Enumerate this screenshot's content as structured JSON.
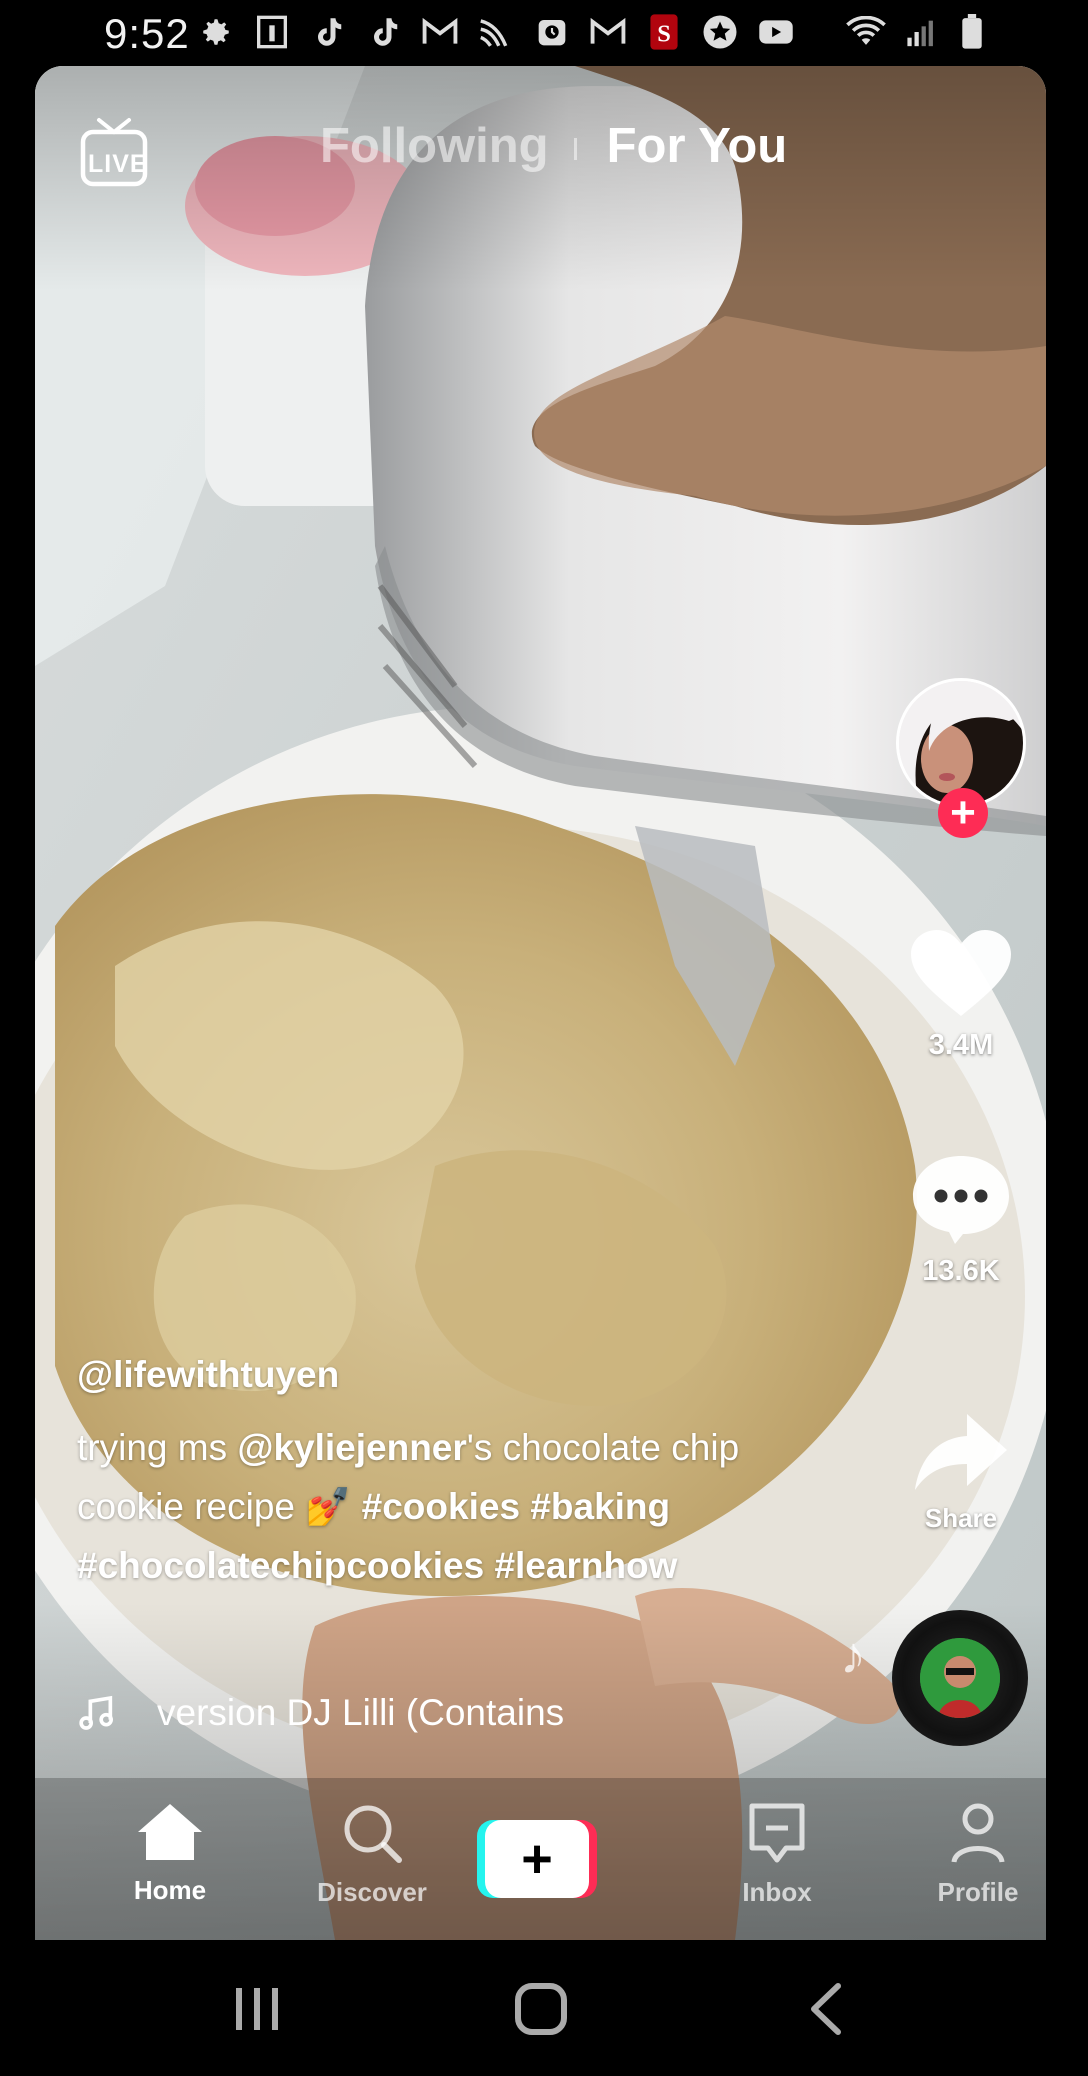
{
  "status_bar": {
    "time": "9:52",
    "icons": [
      "settings-icon",
      "notification-icon",
      "tiktok-icon",
      "tiktok-icon",
      "gmail-icon",
      "sprint-icon",
      "alarm-icon",
      "gmail-icon",
      "stanford-icon",
      "star-icon",
      "youtube-icon"
    ],
    "right_icons": [
      "wifi-icon",
      "signal-icon",
      "battery-icon"
    ]
  },
  "top_nav": {
    "live_label": "LIVE",
    "tabs": [
      {
        "label": "Following",
        "active": false
      },
      {
        "label": "For You",
        "active": true
      }
    ]
  },
  "actions": {
    "like_count": "3.4M",
    "comment_count": "13.6K",
    "share_label": "Share"
  },
  "post": {
    "username": "@lifewithtuyen",
    "caption_prefix": "trying ms ",
    "mention": "@kyliejenner",
    "caption_middle": "'s chocolate chip cookie recipe ",
    "emoji": "💅",
    "hashtags": [
      "#cookies",
      "#baking",
      "#chocolatechipcookies",
      "#learnhow"
    ],
    "sound": "version DJ Lilli (Contains"
  },
  "bottom_nav": {
    "items": [
      {
        "label": "Home",
        "icon": "home-icon",
        "active": true
      },
      {
        "label": "Discover",
        "icon": "search-icon",
        "active": false
      },
      {
        "label": "",
        "icon": "plus-icon",
        "active": false
      },
      {
        "label": "Inbox",
        "icon": "inbox-icon",
        "active": false
      },
      {
        "label": "Profile",
        "icon": "profile-icon",
        "active": false
      }
    ]
  },
  "colors": {
    "accent_red": "#fe2c55",
    "accent_cyan": "#25f4ee"
  }
}
